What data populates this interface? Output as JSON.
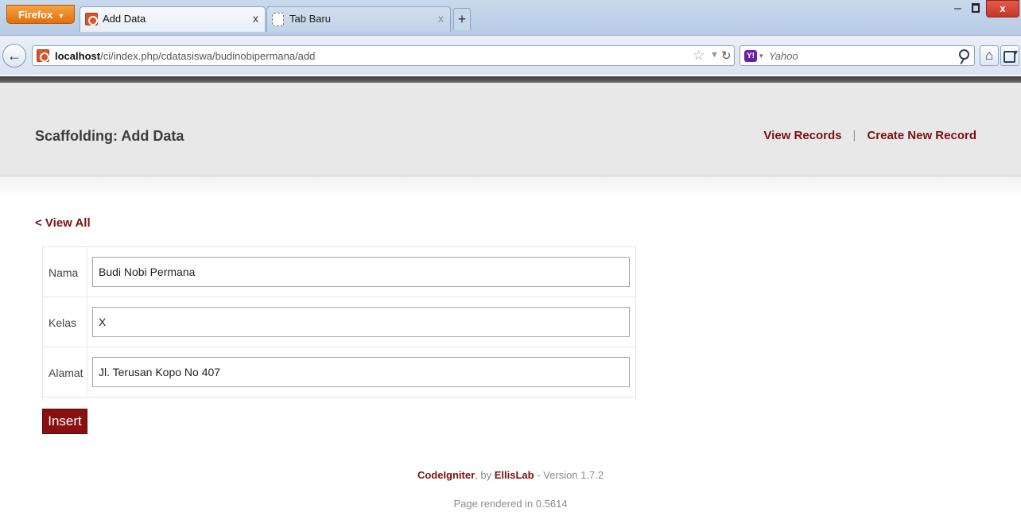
{
  "browser": {
    "menu_button": "Firefox",
    "tabs": [
      {
        "title": "Add Data",
        "close": "x"
      },
      {
        "title": "Tab Baru",
        "close": "x"
      }
    ],
    "new_tab": "+",
    "window_controls": {
      "minimize": "–",
      "close": "x"
    },
    "url_host": "localhost",
    "url_path": "/ci/index.php/cdatasiswa/budinobipermana/add",
    "search_engine": "Yahoo",
    "search_logo": "Y!"
  },
  "header": {
    "title": "Scaffolding:  Add Data",
    "nav": [
      {
        "label": "View Records"
      },
      {
        "label": "Create New Record"
      }
    ],
    "separator": "|"
  },
  "main": {
    "view_all_link": "< View All",
    "fields": [
      {
        "label": "Nama",
        "value": "Budi Nobi Permana"
      },
      {
        "label": "Kelas",
        "value": "X"
      },
      {
        "label": "Alamat",
        "value": "Jl. Terusan Kopo No 407"
      }
    ],
    "submit_label": "Insert"
  },
  "footer": {
    "framework": "CodeIgniter",
    "by": ", by ",
    "company": "EllisLab",
    "version": " - Version 1.7.2",
    "rendered": "Page rendered in 0.5614"
  },
  "colors": {
    "accent": "#7b1010",
    "button": "#8a1010",
    "header_bg": "#e8e8e8"
  }
}
